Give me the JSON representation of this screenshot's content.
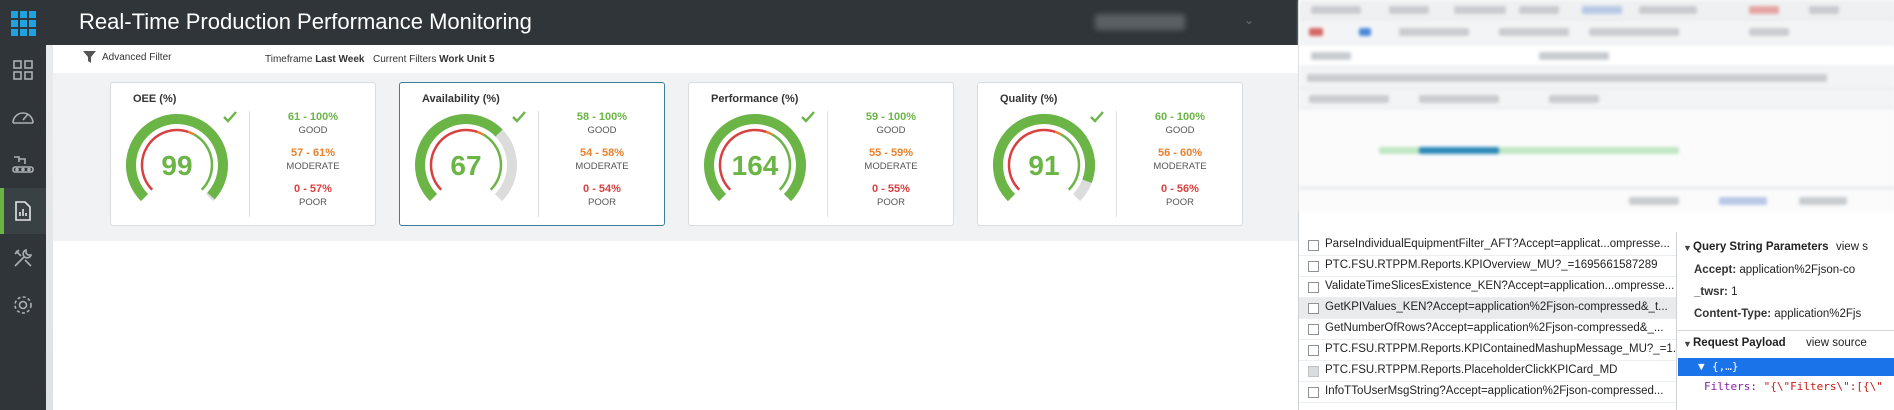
{
  "app": {
    "title": "Real-Time Production Performance Monitoring"
  },
  "colors": {
    "good": "#6ab545",
    "moderate": "#e8812d",
    "poor": "#d94040",
    "accent": "#1fa3e0",
    "topbar": "#2f3538"
  },
  "sidebar": {
    "items": [
      {
        "icon": "dashboard-grid-icon"
      },
      {
        "icon": "speedometer-icon"
      },
      {
        "icon": "production-line-icon"
      },
      {
        "icon": "report-chart-icon",
        "active": true
      },
      {
        "icon": "tools-icon"
      },
      {
        "icon": "settings-gear-icon"
      }
    ]
  },
  "filter_bar": {
    "advanced_filter": "Advanced Filter",
    "timeframe_label": "Timeframe",
    "timeframe_value": "Last Week",
    "current_filters_label": "Current Filters",
    "current_filters_value": "Work Unit 5"
  },
  "kpis": [
    {
      "title": "OEE (%)",
      "value": "99",
      "gauge_fraction": 0.99,
      "good_range": "61 - 100%",
      "moderate_range": "57 - 61%",
      "poor_range": "0 - 57%",
      "good_label": "GOOD",
      "moderate_label": "MODERATE",
      "poor_label": "POOR"
    },
    {
      "title": "Availability (%)",
      "value": "67",
      "gauge_fraction": 0.67,
      "good_range": "58 - 100%",
      "moderate_range": "54 - 58%",
      "poor_range": "0 - 54%",
      "good_label": "GOOD",
      "moderate_label": "MODERATE",
      "poor_label": "POOR"
    },
    {
      "title": "Performance (%)",
      "value": "164",
      "gauge_fraction": 1.0,
      "good_range": "59 - 100%",
      "moderate_range": "55 - 59%",
      "poor_range": "0 - 55%",
      "good_label": "GOOD",
      "moderate_label": "MODERATE",
      "poor_label": "POOR"
    },
    {
      "title": "Quality (%)",
      "value": "91",
      "gauge_fraction": 0.91,
      "good_range": "60 - 100%",
      "moderate_range": "56 - 60%",
      "poor_range": "0 - 56%",
      "good_label": "GOOD",
      "moderate_label": "MODERATE",
      "poor_label": "POOR"
    }
  ],
  "devtools": {
    "requests": [
      "ParseIndividualEquipmentFilter_AFT?Accept=applicat...ompresse...",
      "PTC.FSU.RTPPM.Reports.KPIOverview_MU?_=1695661587289",
      "ValidateTimeSlicesExistence_KEN?Accept=application...ompresse...",
      "GetKPIValues_KEN?Accept=application%2Fjson-compressed&_t...",
      "GetNumberOfRows?Accept=application%2Fjson-compressed&_...",
      "PTC.FSU.RTPPM.Reports.KPIContainedMashupMessage_MU?_=1...",
      "PTC.FSU.RTPPM.Reports.PlaceholderClickKPICard_MD",
      "InfoTToUserMsgString?Accept=application%2Fjson-compressed..."
    ],
    "query_string": {
      "title": "Query String Parameters",
      "view_link": "view s",
      "params": [
        {
          "key": "Accept:",
          "value": "application%2Fjson-co"
        },
        {
          "key": "_twsr:",
          "value": "1"
        },
        {
          "key": "Content-Type:",
          "value": "application%2Fjs"
        }
      ]
    },
    "payload": {
      "title": "Request Payload",
      "view_link": "view source",
      "root": "{,…}",
      "filters_key": "Filters:",
      "filters_value": "\"{\\\"Filters\\\":[{\\\""
    }
  }
}
